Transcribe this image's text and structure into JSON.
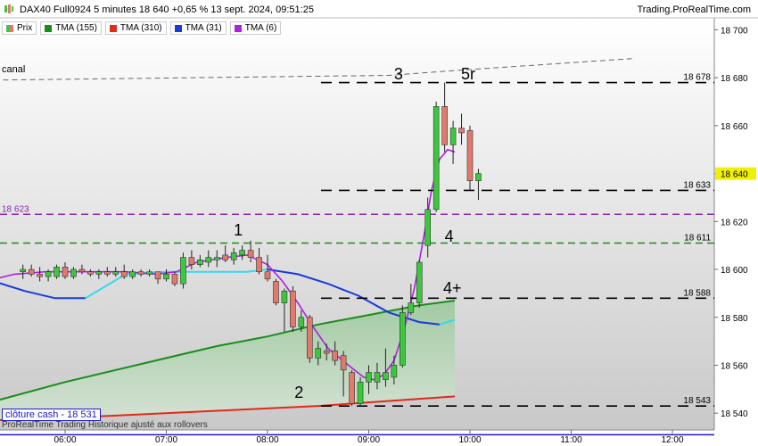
{
  "header": {
    "title": "DAX40 Full0924 5 minutes 18 640 +0,65 % 13 sept. 2024, 09:51:25",
    "brand": "Trading.ProRealTime.com"
  },
  "legend": [
    {
      "label": "Prix",
      "color": "#e07a6c"
    },
    {
      "label": "TMA (155)",
      "color": "#1a8c1a"
    },
    {
      "label": "TMA (310)",
      "color": "#e02a1a"
    },
    {
      "label": "TMA (31)",
      "color": "#1a3adb"
    },
    {
      "label": "TMA (6)",
      "color": "#b020e0"
    }
  ],
  "footer": {
    "close_label": "clôture cash - 18 531",
    "note": "ProRealTime Trading Historique ajusté aux rollovers"
  },
  "annotations": {
    "canal": "canal",
    "wave1": "1",
    "wave2": "2",
    "wave3": "3",
    "wave4": "4",
    "wave4plus": "4+",
    "wave5r": "5r"
  },
  "colors": {
    "bull": "#3cc83c",
    "bear": "#e07a6c",
    "tma6": "#b020e0",
    "tma31_below": "#1a3adb",
    "tma31_above": "#34d8f0",
    "tma155": "#1a8c1a",
    "tma310": "#e02a1a",
    "level_line": "#000000",
    "purple_level": "#8a2ab0",
    "green_level": "#1a8c1a",
    "close_line": "#1a1acc",
    "current_price_bg": "#f0f000"
  },
  "chart_data": {
    "type": "candlestick",
    "ylim": [
      18533,
      18705
    ],
    "y_ticks": [
      "18 540",
      "18 560",
      "18 580",
      "18 600",
      "18 620",
      "18 640",
      "18 660",
      "18 680",
      "18 700"
    ],
    "x_ticks": [
      "06:00",
      "07:00",
      "08:00",
      "09:00",
      "10:00",
      "11:00",
      "12:00"
    ],
    "current_price": "18 640",
    "levels": [
      {
        "value": 18678,
        "label": "18 678",
        "style": "black-dashed"
      },
      {
        "value": 18633,
        "label": "18 633",
        "style": "black-dashed"
      },
      {
        "value": 18623,
        "label": "18 623",
        "style": "purple-dashed"
      },
      {
        "value": 18611,
        "label": "18 611",
        "style": "green-dashed"
      },
      {
        "value": 18588,
        "label": "18 588",
        "style": "black-dashed"
      },
      {
        "value": 18543,
        "label": "18 543",
        "style": "black-dashed"
      }
    ],
    "close_cash": 18531,
    "candles": [
      {
        "t": "05:35",
        "o": 18599,
        "h": 18602,
        "l": 18596,
        "c": 18600
      },
      {
        "t": "05:40",
        "o": 18600,
        "h": 18602,
        "l": 18597,
        "c": 18598
      },
      {
        "t": "05:45",
        "o": 18598,
        "h": 18601,
        "l": 18595,
        "c": 18597
      },
      {
        "t": "05:50",
        "o": 18597,
        "h": 18600,
        "l": 18595,
        "c": 18599
      },
      {
        "t": "05:55",
        "o": 18597,
        "h": 18602,
        "l": 18596,
        "c": 18601
      },
      {
        "t": "06:00",
        "o": 18601,
        "h": 18603,
        "l": 18596,
        "c": 18597
      },
      {
        "t": "06:05",
        "o": 18597,
        "h": 18601,
        "l": 18596,
        "c": 18600
      },
      {
        "t": "06:10",
        "o": 18600,
        "h": 18602,
        "l": 18598,
        "c": 18599
      },
      {
        "t": "06:15",
        "o": 18599,
        "h": 18600,
        "l": 18597,
        "c": 18598
      },
      {
        "t": "06:20",
        "o": 18598,
        "h": 18600,
        "l": 18596,
        "c": 18599
      },
      {
        "t": "06:25",
        "o": 18599,
        "h": 18601,
        "l": 18597,
        "c": 18598
      },
      {
        "t": "06:30",
        "o": 18598,
        "h": 18601,
        "l": 18597,
        "c": 18599
      },
      {
        "t": "06:35",
        "o": 18599,
        "h": 18602,
        "l": 18596,
        "c": 18597
      },
      {
        "t": "06:40",
        "o": 18597,
        "h": 18600,
        "l": 18596,
        "c": 18599
      },
      {
        "t": "06:45",
        "o": 18599,
        "h": 18600,
        "l": 18597,
        "c": 18598
      },
      {
        "t": "06:50",
        "o": 18598,
        "h": 18600,
        "l": 18597,
        "c": 18599
      },
      {
        "t": "06:55",
        "o": 18599,
        "h": 18599,
        "l": 18594,
        "c": 18596
      },
      {
        "t": "07:00",
        "o": 18596,
        "h": 18600,
        "l": 18595,
        "c": 18598
      },
      {
        "t": "07:05",
        "o": 18598,
        "h": 18599,
        "l": 18593,
        "c": 18594
      },
      {
        "t": "07:10",
        "o": 18594,
        "h": 18607,
        "l": 18592,
        "c": 18605
      },
      {
        "t": "07:15",
        "o": 18605,
        "h": 18608,
        "l": 18600,
        "c": 18602
      },
      {
        "t": "07:20",
        "o": 18602,
        "h": 18606,
        "l": 18601,
        "c": 18604
      },
      {
        "t": "07:25",
        "o": 18603,
        "h": 18608,
        "l": 18601,
        "c": 18605
      },
      {
        "t": "07:30",
        "o": 18604,
        "h": 18608,
        "l": 18601,
        "c": 18605
      },
      {
        "t": "07:35",
        "o": 18606,
        "h": 18610,
        "l": 18603,
        "c": 18604
      },
      {
        "t": "07:40",
        "o": 18604,
        "h": 18609,
        "l": 18602,
        "c": 18607
      },
      {
        "t": "07:45",
        "o": 18606,
        "h": 18610,
        "l": 18604,
        "c": 18608
      },
      {
        "t": "07:50",
        "o": 18608,
        "h": 18612,
        "l": 18603,
        "c": 18605
      },
      {
        "t": "07:55",
        "o": 18605,
        "h": 18609,
        "l": 18598,
        "c": 18599
      },
      {
        "t": "08:00",
        "o": 18599,
        "h": 18606,
        "l": 18595,
        "c": 18596
      },
      {
        "t": "08:05",
        "o": 18595,
        "h": 18596,
        "l": 18585,
        "c": 18586
      },
      {
        "t": "08:10",
        "o": 18586,
        "h": 18592,
        "l": 18574,
        "c": 18591
      },
      {
        "t": "08:15",
        "o": 18591,
        "h": 18593,
        "l": 18574,
        "c": 18576
      },
      {
        "t": "08:20",
        "o": 18576,
        "h": 18583,
        "l": 18574,
        "c": 18580
      },
      {
        "t": "08:25",
        "o": 18580,
        "h": 18581,
        "l": 18561,
        "c": 18563
      },
      {
        "t": "08:30",
        "o": 18563,
        "h": 18570,
        "l": 18560,
        "c": 18567
      },
      {
        "t": "08:35",
        "o": 18566,
        "h": 18569,
        "l": 18562,
        "c": 18565
      },
      {
        "t": "08:40",
        "o": 18566,
        "h": 18570,
        "l": 18560,
        "c": 18562
      },
      {
        "t": "08:45",
        "o": 18564,
        "h": 18566,
        "l": 18547,
        "c": 18558
      },
      {
        "t": "08:50",
        "o": 18557,
        "h": 18558,
        "l": 18543,
        "c": 18544
      },
      {
        "t": "08:55",
        "o": 18544,
        "h": 18555,
        "l": 18543,
        "c": 18553
      },
      {
        "t": "09:00",
        "o": 18553,
        "h": 18560,
        "l": 18548,
        "c": 18557
      },
      {
        "t": "09:05",
        "o": 18553,
        "h": 18561,
        "l": 18550,
        "c": 18557
      },
      {
        "t": "09:10",
        "o": 18554,
        "h": 18567,
        "l": 18551,
        "c": 18557
      },
      {
        "t": "09:15",
        "o": 18555,
        "h": 18564,
        "l": 18552,
        "c": 18560
      },
      {
        "t": "09:20",
        "o": 18560,
        "h": 18585,
        "l": 18559,
        "c": 18582
      },
      {
        "t": "09:25",
        "o": 18582,
        "h": 18594,
        "l": 18581,
        "c": 18586
      },
      {
        "t": "09:30",
        "o": 18586,
        "h": 18604,
        "l": 18584,
        "c": 18603
      },
      {
        "t": "09:35",
        "o": 18610,
        "h": 18630,
        "l": 18605,
        "c": 18625
      },
      {
        "t": "09:40",
        "o": 18625,
        "h": 18670,
        "l": 18624,
        "c": 18668
      },
      {
        "t": "09:45",
        "o": 18668,
        "h": 18678,
        "l": 18649,
        "c": 18652
      },
      {
        "t": "09:50",
        "o": 18652,
        "h": 18662,
        "l": 18644,
        "c": 18659
      },
      {
        "t": "09:55",
        "o": 18659,
        "h": 18665,
        "l": 18652,
        "c": 18657
      },
      {
        "t": "10:00",
        "o": 18658,
        "h": 18660,
        "l": 18633,
        "c": 18637
      },
      {
        "t": "10:05",
        "o": 18637,
        "h": 18642,
        "l": 18629,
        "c": 18640
      }
    ],
    "series": [
      {
        "name": "TMA (310)",
        "values": [
          [
            5.3,
            18537
          ],
          [
            6.5,
            18539
          ],
          [
            7.5,
            18541
          ],
          [
            8.5,
            18543
          ],
          [
            9.5,
            18546
          ],
          [
            9.85,
            18547
          ]
        ]
      },
      {
        "name": "TMA (155)",
        "values": [
          [
            5.3,
            18545
          ],
          [
            6.0,
            18553
          ],
          [
            6.5,
            18558
          ],
          [
            7.0,
            18563
          ],
          [
            7.5,
            18568
          ],
          [
            8.0,
            18572
          ],
          [
            8.5,
            18577
          ],
          [
            9.0,
            18581
          ],
          [
            9.5,
            18585
          ],
          [
            9.85,
            18587
          ]
        ]
      },
      {
        "name": "TMA (31)",
        "values": [
          [
            5.3,
            18595
          ],
          [
            5.6,
            18591
          ],
          [
            5.9,
            18588
          ],
          [
            6.2,
            18588
          ],
          [
            6.6,
            18598
          ],
          [
            7.0,
            18599
          ],
          [
            7.5,
            18599
          ],
          [
            7.8,
            18599
          ],
          [
            8.0,
            18600
          ],
          [
            8.3,
            18598
          ],
          [
            8.6,
            18594
          ],
          [
            8.9,
            18589
          ],
          [
            9.2,
            18582
          ],
          [
            9.5,
            18578
          ],
          [
            9.7,
            18577
          ],
          [
            9.85,
            18579
          ]
        ]
      },
      {
        "name": "TMA (6)",
        "values": [
          [
            5.3,
            18596
          ],
          [
            5.5,
            18598
          ],
          [
            5.8,
            18599
          ],
          [
            6.2,
            18599
          ],
          [
            6.6,
            18599
          ],
          [
            6.9,
            18598
          ],
          [
            7.1,
            18599
          ],
          [
            7.3,
            18603
          ],
          [
            7.6,
            18605
          ],
          [
            7.8,
            18606
          ],
          [
            8.0,
            18602
          ],
          [
            8.15,
            18595
          ],
          [
            8.3,
            18586
          ],
          [
            8.45,
            18576
          ],
          [
            8.6,
            18567
          ],
          [
            8.8,
            18560
          ],
          [
            8.95,
            18555
          ],
          [
            9.05,
            18554
          ],
          [
            9.15,
            18556
          ],
          [
            9.25,
            18562
          ],
          [
            9.35,
            18575
          ],
          [
            9.45,
            18592
          ],
          [
            9.55,
            18615
          ],
          [
            9.62,
            18633
          ],
          [
            9.7,
            18646
          ],
          [
            9.78,
            18650
          ],
          [
            9.85,
            18649
          ]
        ]
      }
    ],
    "canal_line": [
      [
        5.3,
        18679
      ],
      [
        9.2,
        18681
      ],
      [
        9.85,
        18683
      ],
      [
        11.6,
        18688
      ]
    ]
  }
}
